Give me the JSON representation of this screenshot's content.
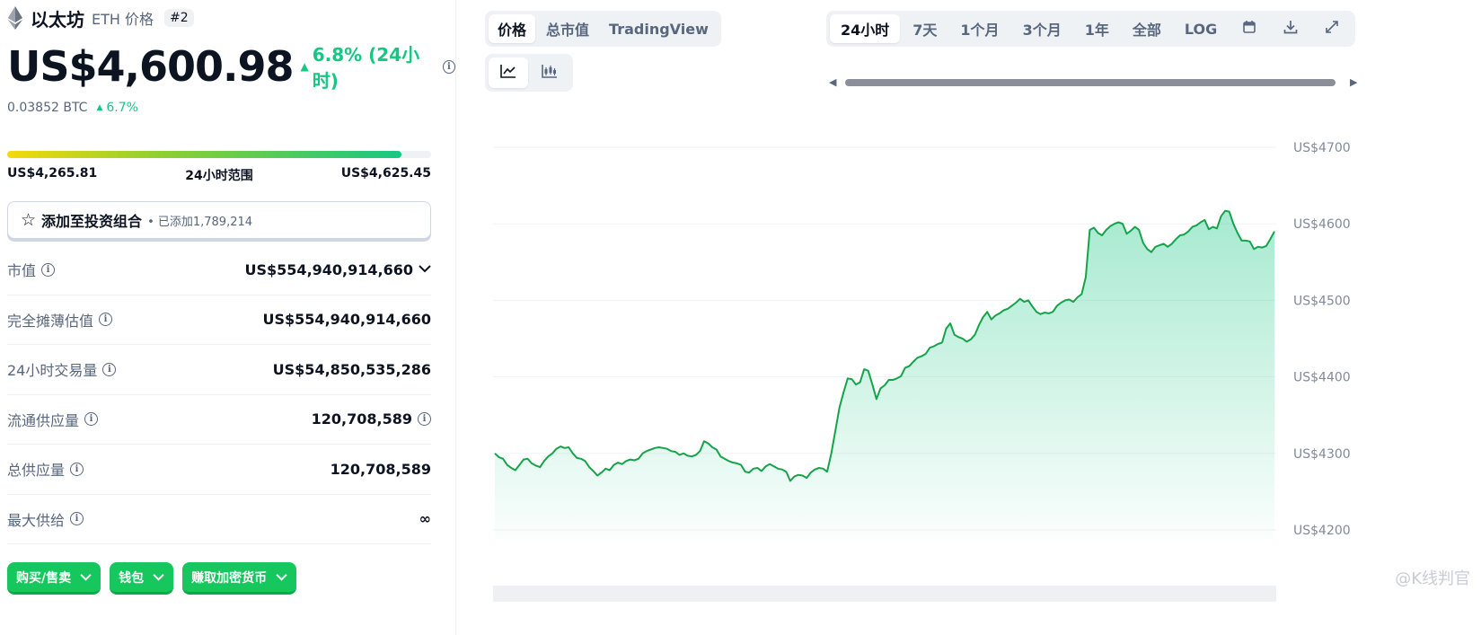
{
  "coin": {
    "name": "以太坊",
    "symbol_label": "ETH 价格",
    "rank": "#2",
    "price": "US$4,600.98",
    "change_24h": "6.8% (24小时)",
    "btc_price": "0.03852 BTC",
    "btc_change": "6.7%"
  },
  "range": {
    "low": "US$4,265.81",
    "label": "24小时范围",
    "high": "US$4,625.45",
    "fill_fraction": 0.93
  },
  "watchlist": {
    "label": "添加至投资组合",
    "count": "• 已添加1,789,214"
  },
  "stats": [
    {
      "label": "市值",
      "value": "US$554,940,914,660"
    },
    {
      "label": "完全摊薄估值",
      "value": "US$554,940,914,660"
    },
    {
      "label": "24小时交易量",
      "value": "US$54,850,535,286"
    },
    {
      "label": "流通供应量",
      "value": "120,708,589"
    },
    {
      "label": "总供应量",
      "value": "120,708,589"
    },
    {
      "label": "最大供给",
      "value": "∞"
    }
  ],
  "actions": [
    {
      "label": "购买/售卖"
    },
    {
      "label": "钱包"
    },
    {
      "label": "赚取加密货币"
    }
  ],
  "chart_tabs": [
    "价格",
    "总市值",
    "TradingView"
  ],
  "time_ranges": [
    "24小时",
    "7天",
    "1个月",
    "3个月",
    "1年",
    "全部",
    "LOG"
  ],
  "icons": {
    "calendar": "calendar-icon",
    "download": "download-icon",
    "expand": "expand-icon",
    "line": "line-chart-icon",
    "candle": "candlestick-icon"
  },
  "colors": {
    "up": "#16c784",
    "line": "#16a34a",
    "button": "#16c75d"
  },
  "watermark": "@K线判官",
  "chart_data": {
    "type": "area",
    "title": "",
    "xlabel": "",
    "ylabel": "",
    "ylim": [
      4180,
      4710
    ],
    "yticks": [
      4200,
      4300,
      4400,
      4500,
      4600,
      4700
    ],
    "ytick_labels": [
      "US$4200",
      "US$4300",
      "US$4400",
      "US$4500",
      "US$4600",
      "US$4700"
    ],
    "grid": true,
    "series": [
      {
        "values": [
          4300,
          4295,
          4293,
          4285,
          4281,
          4278,
          4285,
          4292,
          4293,
          4287,
          4284,
          4282,
          4290,
          4296,
          4300,
          4306,
          4309,
          4307,
          4308,
          4300,
          4294,
          4293,
          4290,
          4282,
          4277,
          4271,
          4275,
          4280,
          4278,
          4285,
          4288,
          4286,
          4290,
          4292,
          4291,
          4293,
          4300,
          4303,
          4305,
          4307,
          4308,
          4307,
          4306,
          4303,
          4302,
          4298,
          4300,
          4297,
          4296,
          4298,
          4303,
          4316,
          4313,
          4308,
          4305,
          4296,
          4293,
          4290,
          4288,
          4287,
          4285,
          4276,
          4275,
          4280,
          4281,
          4277,
          4283,
          4286,
          4283,
          4280,
          4279,
          4276,
          4264,
          4270,
          4272,
          4271,
          4268,
          4275,
          4279,
          4281,
          4280,
          4276,
          4300,
          4330,
          4360,
          4380,
          4398,
          4397,
          4390,
          4393,
          4410,
          4408,
          4390,
          4371,
          4385,
          4389,
          4396,
          4396,
          4398,
          4401,
          4412,
          4414,
          4420,
          4425,
          4427,
          4430,
          4438,
          4440,
          4443,
          4445,
          4463,
          4470,
          4455,
          4452,
          4450,
          4446,
          4449,
          4455,
          4468,
          4478,
          4485,
          4475,
          4480,
          4483,
          4487,
          4489,
          4493,
          4497,
          4502,
          4498,
          4500,
          4492,
          4485,
          4482,
          4484,
          4483,
          4485,
          4493,
          4497,
          4500,
          4501,
          4498,
          4504,
          4508,
          4530,
          4592,
          4595,
          4588,
          4585,
          4592,
          4597,
          4600,
          4602,
          4600,
          4587,
          4591,
          4596,
          4592,
          4575,
          4567,
          4563,
          4570,
          4572,
          4574,
          4570,
          4574,
          4580,
          4585,
          4586,
          4590,
          4596,
          4598,
          4602,
          4605,
          4593,
          4596,
          4594,
          4610,
          4617,
          4616,
          4600,
          4588,
          4578,
          4578,
          4577,
          4567,
          4570,
          4569,
          4571,
          4580,
          4590
        ]
      }
    ]
  }
}
